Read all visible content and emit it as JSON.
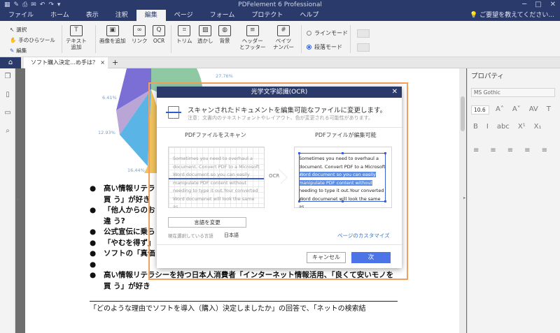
{
  "app": {
    "title": "PDFelement 6 Professional",
    "quick_access": [
      "▦",
      "✎",
      "⎙",
      "✉",
      "↶",
      "↷",
      "▾"
    ],
    "window_controls": [
      "─",
      "□",
      "✕"
    ]
  },
  "menu": {
    "items": [
      "ファイル",
      "ホーム",
      "表示",
      "注釈",
      "編集",
      "ページ",
      "フォーム",
      "プロテクト",
      "ヘルプ"
    ],
    "active_index": 4,
    "help_search": "ご要望を教えてください..."
  },
  "ribbon": {
    "select_group": {
      "select": "選択",
      "hand": "手のひらツール",
      "edit": "編集"
    },
    "tools": [
      {
        "label": "テキスト\n追加",
        "icon": "T"
      },
      {
        "label": "画像を追加",
        "icon": "▣"
      },
      {
        "label": "リンク",
        "icon": "∞"
      },
      {
        "label": "OCR",
        "icon": "Q"
      },
      {
        "label": "トリム",
        "icon": "⌗"
      },
      {
        "label": "透かし",
        "icon": "▨"
      },
      {
        "label": "背景",
        "icon": "◍"
      },
      {
        "label": "ヘッダー\nとフッター",
        "icon": "≡"
      },
      {
        "label": "ベイツ\nナンバー",
        "icon": "#"
      }
    ],
    "line_mode": "ラインモード",
    "paragraph_mode": "段落モード"
  },
  "tabs": {
    "document": "ソフト購入決定…め手は？",
    "close": "×",
    "add": "+"
  },
  "document": {
    "chart_labels": [
      "27.76%",
      "6.41%",
      "12.93%",
      "16.44%"
    ],
    "bullets": [
      "高い情報リテラ",
      "買 う」が好き",
      "「他人からのお",
      "違 う?",
      "公式宣伝に乗ら",
      "「やむを得ず」",
      "ソフトの「真価",
      "",
      "高い情報リテラシーを持つ日本人消費者「インターネット情報活用、「良くて安いモノを",
      "買 う」が好き"
    ],
    "paragraph": "「どのような理由でソフトを導入（購入）決定しましたか」の回答で、「ネットの検索結"
  },
  "properties": {
    "title": "プロパティ",
    "font": "MS Gothic",
    "size": "10.6",
    "row1": [
      "A˄",
      "A˅",
      "AV",
      "T"
    ],
    "row2": [
      "B",
      "I",
      "abc",
      "X¹",
      "X₁"
    ],
    "row3": [
      "≡",
      "≡",
      "≡",
      "≡",
      "≡"
    ]
  },
  "ocr_dialog": {
    "title": "光学文字認識(OCR)",
    "heading": "スキャンされたドキュメントを編集可能なファイルに変更します。",
    "note": "注意：文書内のテキストフォントやレイアウト、色が変更される可能性があります。",
    "left_heading": "PDFファイルをスキャン",
    "right_heading": "PDFファイルが編集可能",
    "arrow_label": "OCR",
    "sample_lines": [
      "Sometimes you need to overhaul a",
      "document. Convert PDF to a Microsoft",
      "Word document so you can easily",
      "manipulate PDF content without",
      "needing to type it out.Your converted",
      "Word documenet will look the same as."
    ],
    "change_language": "言語を変更",
    "current_language_label": "現在選択している言語",
    "current_language": "日本語",
    "customize_pages": "ページのカスタマイズ",
    "cancel": "キャンセル",
    "next": "次"
  }
}
